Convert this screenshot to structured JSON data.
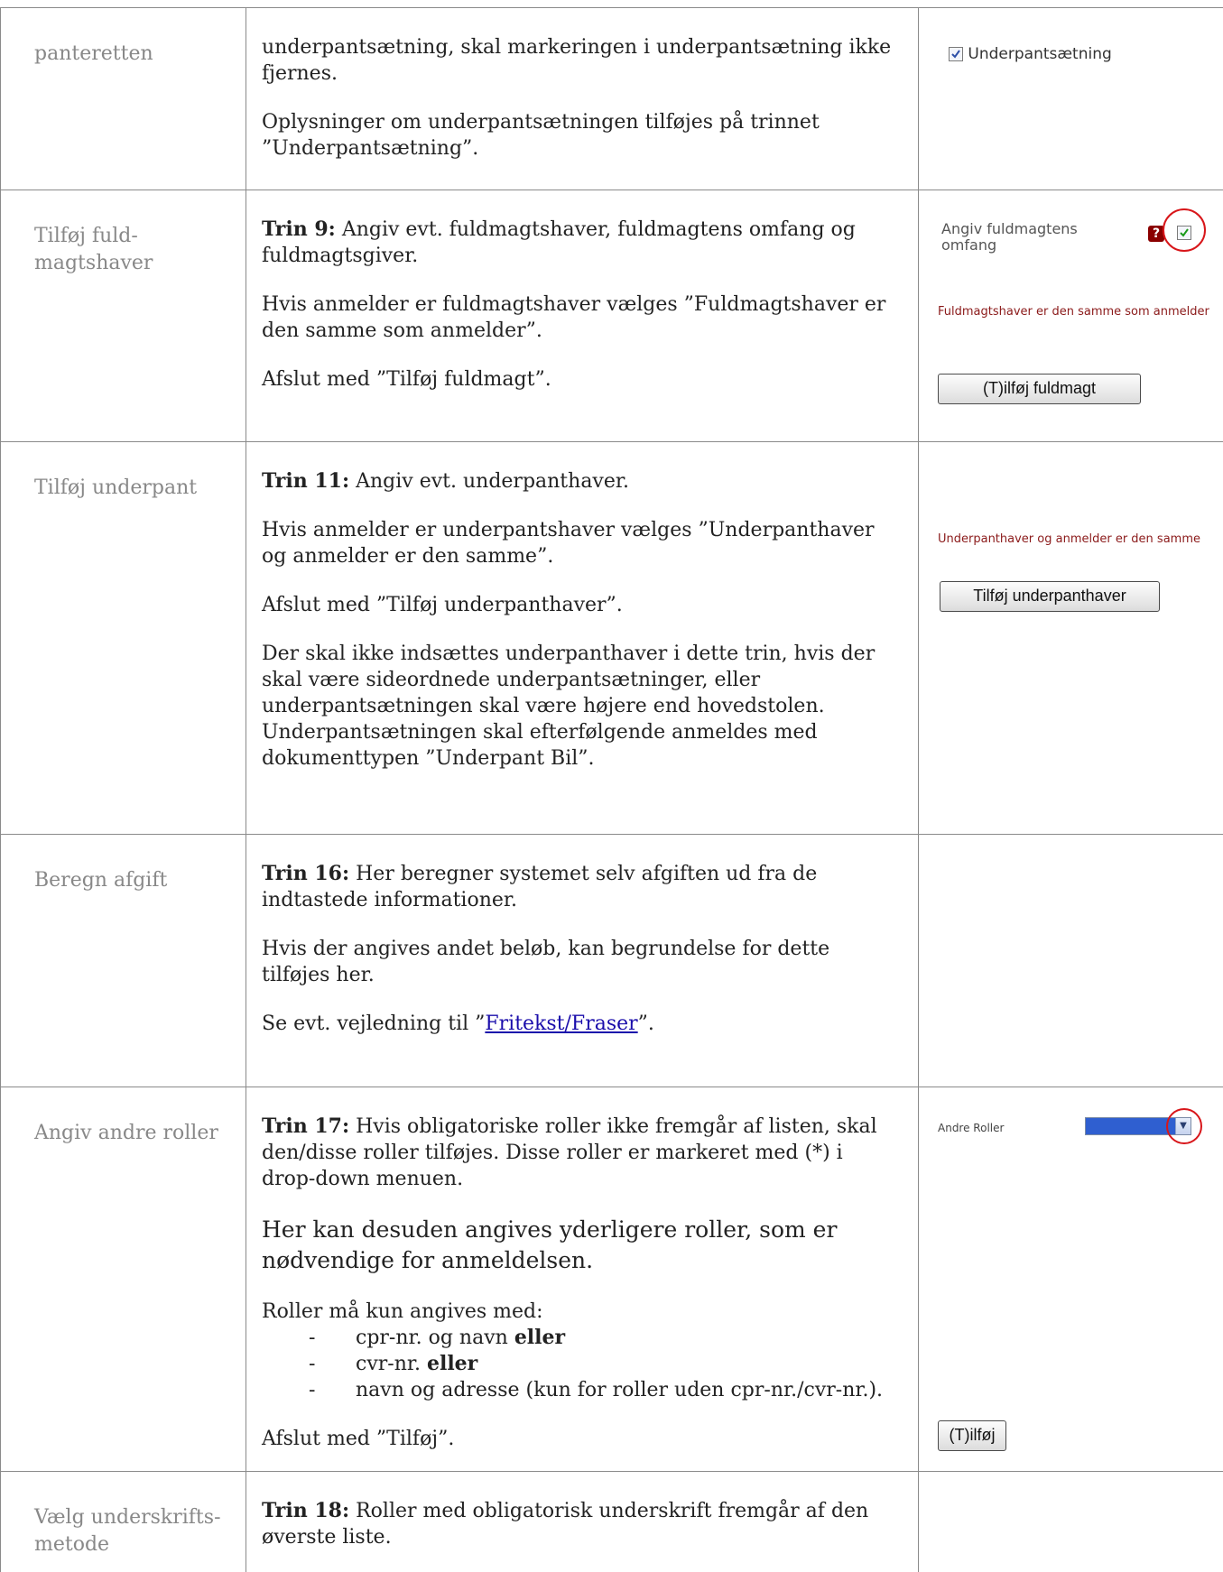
{
  "rows": [
    {
      "label": "panteretten",
      "paragraphs": [
        "underpantsætning, skal markeringen i underpantsætning ikke fjernes.",
        "Oplysninger om underpantsætningen tilføjes på trinnet ”Underpantsætning”."
      ],
      "ui": {
        "checkbox_label": "Underpantsætning"
      }
    },
    {
      "label": "Tilføj fuld-magtshaver",
      "step": "Trin 9:",
      "paragraphs": [
        "Angiv evt. fuldmagtshaver, fuldmagtens omfang og fuldmagtsgiver.",
        "Hvis anmelder er fuldmagtshaver vælges ”Fuldmagtshaver er den samme som anmelder”.",
        "Afslut med ”Tilføj fuldmagt”."
      ],
      "ui": {
        "field_label": "Angiv fuldmagtens omfang",
        "note": "Fuldmagtshaver er den samme som anmelder",
        "button": "(T)ilføj fuldmagt"
      }
    },
    {
      "label": "Tilføj underpant",
      "step": "Trin 11:",
      "paragraphs": [
        "Angiv evt. underpanthaver.",
        "Hvis anmelder er underpantshaver vælges ”Underpanthaver og anmelder er den samme”.",
        "Afslut med ”Tilføj underpanthaver”.",
        "Der skal ikke indsættes underpanthaver i dette trin, hvis der skal være sideordnede underpantsætninger, eller underpantsætningen skal være højere end hovedstolen. Underpantsætningen skal efterfølgende anmeldes med dokumenttypen ”Underpant Bil”."
      ],
      "ui": {
        "note": "Underpanthaver og anmelder er den samme",
        "button": "Tilføj underpanthaver"
      }
    },
    {
      "label": "Beregn afgift",
      "step": "Trin 16:",
      "paragraphs": [
        "Her beregner systemet selv afgiften ud fra de indtastede informationer.",
        "Hvis der angives andet beløb, kan begrundelse for dette tilføjes her.",
        "Se evt. vejledning til ”",
        "Fritekst/Fraser",
        "”."
      ]
    },
    {
      "label": "Angiv andre roller",
      "step": "Trin 17:",
      "paragraphs": [
        "Hvis obligatoriske roller ikke fremgår af listen, skal den/disse roller tilføjes. Disse roller er markeret med (*) i drop-down menuen.",
        "Her kan desuden angives yderligere roller, som er nødvendige for anmeldelsen.",
        "Roller må kun angives med:",
        "Afslut med ”Tilføj”."
      ],
      "list": [
        {
          "text": "cpr-nr. og navn ",
          "bold": "eller"
        },
        {
          "text": "cvr-nr. ",
          "bold": "eller"
        },
        {
          "text": "navn og adresse (kun for roller uden cpr-nr./cvr-nr.).",
          "bold": ""
        }
      ],
      "ui": {
        "field_label": "Andre Roller",
        "button": "(T)ilføj"
      }
    },
    {
      "label": "Vælg underskrifts-metode",
      "step": "Trin 18:",
      "paragraphs": [
        "Roller med obligatorisk underskrift fremgår af den øverste liste."
      ]
    }
  ],
  "colors": {
    "annotation_circle": "#d8161a",
    "note_text": "#8b1a1a",
    "link": "#1a0dab",
    "dropdown_fill": "#2f5fd0"
  }
}
